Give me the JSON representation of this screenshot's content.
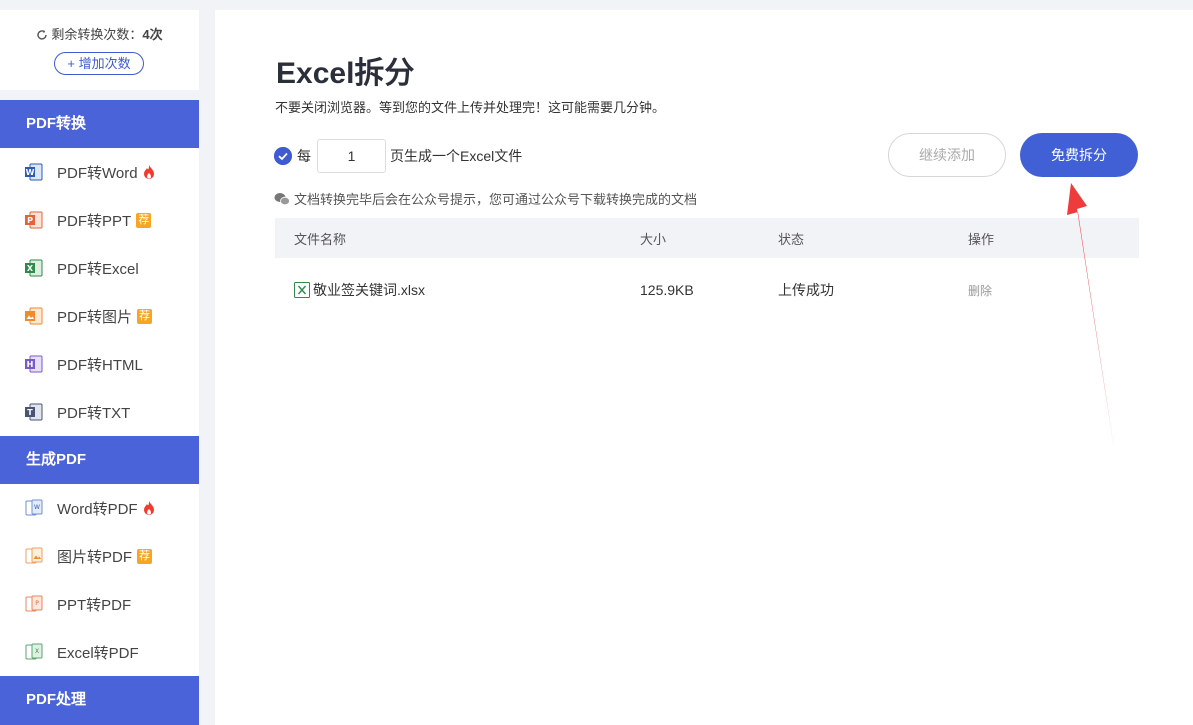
{
  "credits": {
    "label": "剩余转换次数：",
    "count": "4次",
    "add_label": "+ 增加次数"
  },
  "sections": {
    "pdf_convert": "PDF转换",
    "make_pdf": "生成PDF",
    "pdf_process": "PDF处理"
  },
  "nav": {
    "pdf_word": "PDF转Word",
    "pdf_ppt": "PDF转PPT",
    "pdf_excel": "PDF转Excel",
    "pdf_image": "PDF转图片",
    "pdf_html": "PDF转HTML",
    "pdf_txt": "PDF转TXT",
    "word_pdf": "Word转PDF",
    "image_pdf": "图片转PDF",
    "ppt_pdf": "PPT转PDF",
    "excel_pdf": "Excel转PDF",
    "rec_badge": "荐"
  },
  "main": {
    "title": "Excel拆分",
    "subtitle": "不要关闭浏览器。等到您的文件上传并处理完！这可能需要几分钟。",
    "per_label": "每",
    "pages_value": "1",
    "per_suffix": "页生成一个Excel文件",
    "continue_label": "继续添加",
    "split_label": "免费拆分",
    "hint": "文档转换完毕后会在公众号提示，您可通过公众号下载转换完成的文档"
  },
  "table": {
    "headers": [
      "文件名称",
      "大小",
      "状态",
      "操作"
    ],
    "rows": [
      {
        "name": "敬业签关键词.xlsx",
        "size": "125.9KB",
        "status": "上传成功",
        "action": "删除"
      }
    ]
  },
  "colors": {
    "accent": "#4160d6",
    "sidebar_head": "#4b63d9",
    "badge": "#f5a623",
    "arrow": "#ee3b3b"
  }
}
